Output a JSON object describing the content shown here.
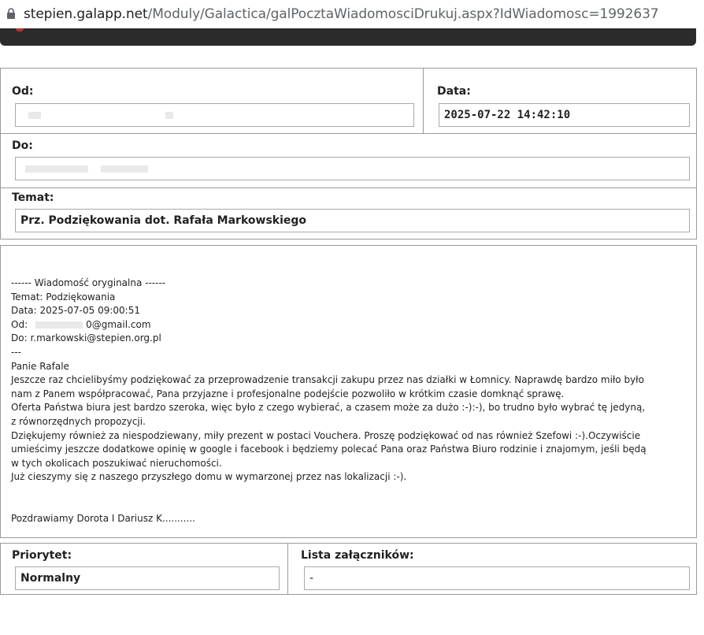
{
  "browser": {
    "url_host": "stepien.galapp.net",
    "url_path": "/Moduly/Galactica/galPocztaWiadomosciDrukuj.aspx?IdWiadomosc=1992637"
  },
  "header": {
    "from_label": "Od:",
    "from_value": "",
    "date_label": "Data:",
    "date_value": "2025-07-22 14:42:10",
    "to_label": "Do:",
    "to_value": "",
    "subject_label": "Temat:",
    "subject_value": "Prz. Podziękowania dot. Rafała Markowskiego"
  },
  "message": {
    "orig_header": "------ Wiadomość oryginalna ------",
    "orig_subject": "Temat: Podziękowania",
    "orig_date": "Data: 2025-07-05 09:00:51",
    "orig_from_prefix": "Od:",
    "orig_from_suffix": "0@gmail.com",
    "orig_to": "Do: r.markowski@stepien.org.pl",
    "separator": "---",
    "greeting": "Panie Rafale",
    "body_lines": [
      "Jeszcze raz chcielibyśmy podziękować za przeprowadzenie transakcji zakupu przez nas działki w Łomnicy. Naprawdę bardzo miło było",
      "nam z Panem współpracować, Pana przyjazne i profesjonalne podejście pozwoliło w krótkim czasie domknąć sprawę.",
      "Oferta Państwa biura jest bardzo szeroka, więc było z czego wybierać, a czasem może za dużo :-):-), bo trudno było wybrać tę jedyną,",
      "z równorzędnych propozycji.",
      "Dziękujemy również za niespodziewany, miły prezent w postaci Vouchera. Proszę podziękować od nas również Szefowi :-).Oczywiście",
      "umieścimy jeszcze dodatkowe opinię w google i facebook i będziemy polecać Pana oraz Państwa Biuro rodzinie i znajomym, jeśli będą",
      "w tych okolicach poszukiwać nieruchomości.",
      "Już cieszymy się z naszego przyszłego domu w wymarzonej przez nas lokalizacji :-)."
    ],
    "signature": "Pozdrawiamy Dorota I Dariusz K..........."
  },
  "footer": {
    "priority_label": "Priorytet:",
    "priority_value": "Normalny",
    "attachments_label": "Lista załączników:",
    "attachments_value": "-"
  }
}
